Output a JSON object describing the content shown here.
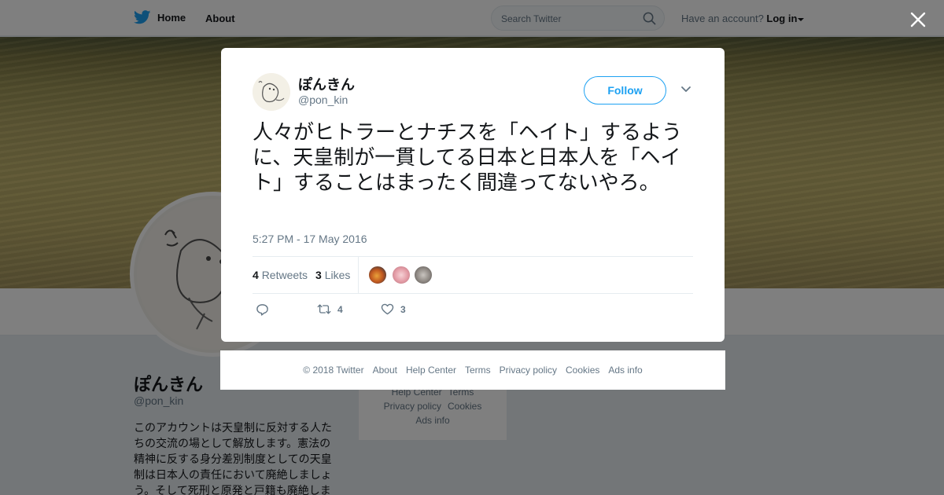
{
  "topbar": {
    "home_label": "Home",
    "about_label": "About",
    "search_placeholder": "Search Twitter",
    "account_prompt": "Have an account?",
    "login_label": "Log in"
  },
  "profile": {
    "name": "ぽんきん",
    "handle": "@pon_kin",
    "bio": "このアカウントは天皇制に反対する人たちの交流の場として解放します。憲法の精神に反する身分差別制度としての天皇制は日本人の責任において廃絶しましょう。そして死刑と原発と戸籍も廃絶しま",
    "footer_links": [
      "Help Center",
      "Terms",
      "Privacy policy",
      "Cookies",
      "Ads info"
    ]
  },
  "tweet": {
    "author_name": "ぽんきん",
    "author_handle": "@pon_kin",
    "follow_label": "Follow",
    "text": "人々がヒトラーとナチスを「ヘイト」するように、天皇制が一貫してる日本と日本人を「ヘイト」することはまったく間違ってないやろ。",
    "timestamp": "5:27 PM - 17 May 2016",
    "retweets_count": "4",
    "retweets_label": "Retweets",
    "likes_count": "3",
    "likes_label": "Likes",
    "action_retweet_count": "4",
    "action_like_count": "3"
  },
  "footer": {
    "copyright": "© 2018 Twitter",
    "links": [
      "About",
      "Help Center",
      "Terms",
      "Privacy policy",
      "Cookies",
      "Ads info"
    ]
  },
  "colors": {
    "brand": "#1da1f2",
    "text_primary": "#14171a",
    "text_secondary": "#657786"
  }
}
